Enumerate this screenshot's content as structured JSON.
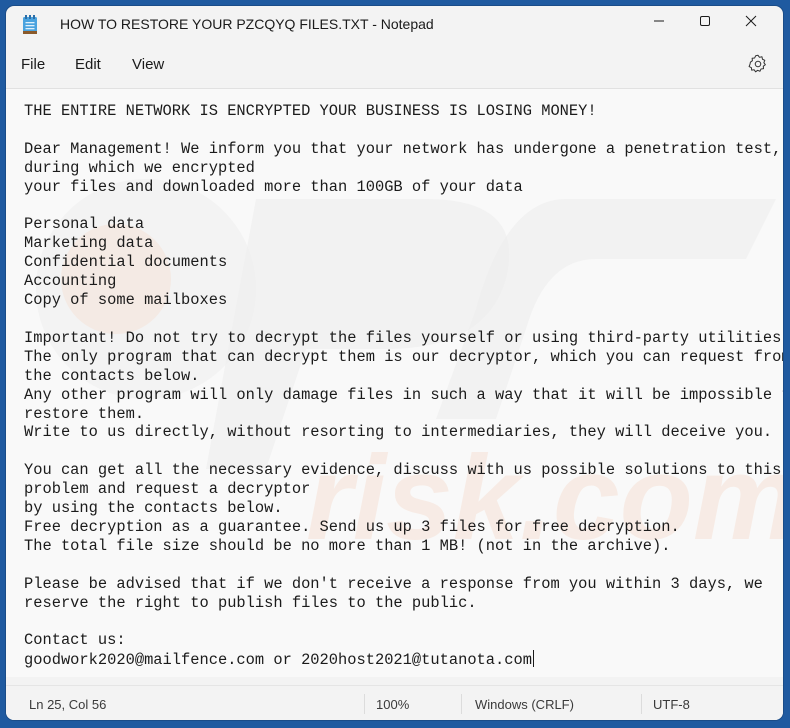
{
  "window": {
    "title": "HOW TO RESTORE YOUR PZCQYQ FILES.TXT - Notepad",
    "app_icon": "notepad-icon",
    "caption_buttons": {
      "minimize": "minimize-icon",
      "maximize": "maximize-icon",
      "close": "close-icon"
    }
  },
  "menu": {
    "items": [
      {
        "label": "File"
      },
      {
        "label": "Edit"
      },
      {
        "label": "View"
      }
    ],
    "settings_icon": "gear-icon"
  },
  "document": {
    "lines": [
      "THE ENTIRE NETWORK IS ENCRYPTED YOUR BUSINESS IS LOSING MONEY!",
      "",
      "Dear Management! We inform you that your network has undergone a penetration test,",
      "during which we encrypted",
      "your files and downloaded more than 100GB of your data",
      "",
      "Personal data",
      "Marketing data",
      "Confidential documents",
      "Accounting",
      "Copy of some mailboxes",
      "",
      "Important! Do not try to decrypt the files yourself or using third-party utilities.",
      "The only program that can decrypt them is our decryptor, which you can request from",
      "the contacts below.",
      "Any other program will only damage files in such a way that it will be impossible to",
      "restore them.",
      "Write to us directly, without resorting to intermediaries, they will deceive you.",
      "",
      "You can get all the necessary evidence, discuss with us possible solutions to this",
      "problem and request a decryptor",
      "by using the contacts below.",
      "Free decryption as a guarantee. Send us up 3 files for free decryption.",
      "The total file size should be no more than 1 MB! (not in the archive).",
      "",
      "Please be advised that if we don't receive a response from you within 3 days, we",
      "reserve the right to publish files to the public.",
      "",
      "Contact us:",
      "goodwork2020@mailfence.com or 2020host2021@tutanota.com"
    ]
  },
  "status_bar": {
    "position": "Ln 25, Col 56",
    "zoom": "100%",
    "line_ending": "Windows (CRLF)",
    "encoding": "UTF-8"
  },
  "colors": {
    "desktop": "#1f5aa0",
    "window_chrome": "#f3f3f3",
    "editor_bg": "#f9f9f9",
    "text": "#1b1b1b"
  }
}
